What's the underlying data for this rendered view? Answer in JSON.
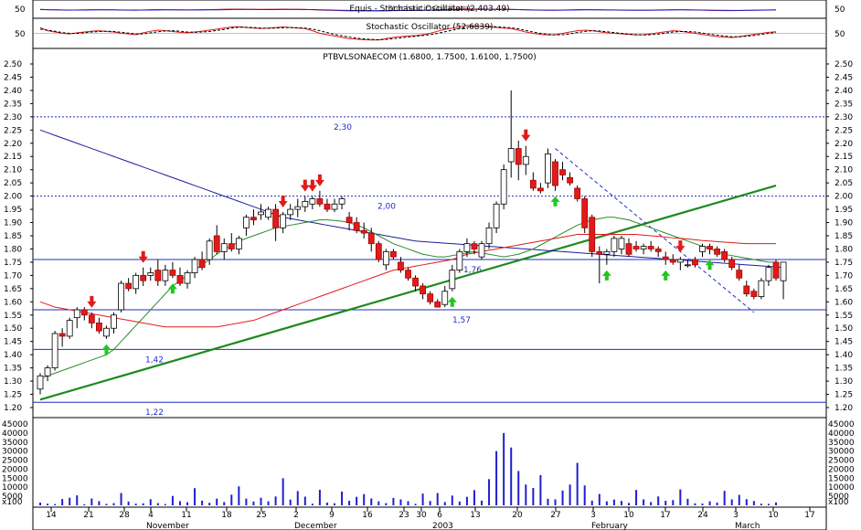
{
  "panels": {
    "top_title": "Equis - Stochastic Oscillator (2,403.49)",
    "top_title_overlap": "Stochastic Oscillator",
    "stoch_title": "Stochastic Oscillator (52.6839)",
    "stoch_label": "50",
    "price_title": "PTBVLSONAECOM (1.6800, 1.7500, 1.6100, 1.7500)",
    "volume_unit": "x100"
  },
  "chart_data": {
    "type": "candlestick",
    "title": "PTBVLSONAECOM (1.6800, 1.7500, 1.6100, 1.7500)",
    "ylim": [
      1.2,
      2.5
    ],
    "y_ticks": [
      "1.20",
      "1.25",
      "1.30",
      "1.35",
      "1.40",
      "1.45",
      "1.50",
      "1.55",
      "1.60",
      "1.65",
      "1.70",
      "1.75",
      "1.80",
      "1.85",
      "1.90",
      "1.95",
      "2.00",
      "2.05",
      "2.10",
      "2.15",
      "2.20",
      "2.25",
      "2.30",
      "2.35",
      "2.40",
      "2.45",
      "2.50"
    ],
    "volume_ylim": [
      0,
      45000
    ],
    "volume_ticks": [
      "5000",
      "10000",
      "15000",
      "20000",
      "25000",
      "30000",
      "35000",
      "40000",
      "45000"
    ],
    "x_ticks": [
      "14",
      "21",
      "28",
      "4",
      "11",
      "18",
      "25",
      "2",
      "9",
      "16",
      "23",
      "30",
      "6",
      "13",
      "20",
      "27",
      "3",
      "10",
      "17",
      "24",
      "3",
      "10",
      "17"
    ],
    "x_months": [
      "November",
      "December",
      "2003",
      "February",
      "March"
    ],
    "horizontal_levels": [
      {
        "value": 2.3,
        "label": "2,30",
        "style": "dotted"
      },
      {
        "value": 2.0,
        "label": "2,00",
        "style": "dotted"
      },
      {
        "value": 1.76,
        "label": "1,76",
        "style": "solid"
      },
      {
        "value": 1.57,
        "label": "1,57",
        "style": "solid"
      },
      {
        "value": 1.42,
        "label": "1,42",
        "style": "solid"
      },
      {
        "value": 1.22,
        "label": "1,22",
        "style": "solid"
      }
    ],
    "candles": [
      [
        1.27,
        1.33,
        1.25,
        1.32
      ],
      [
        1.32,
        1.36,
        1.3,
        1.35
      ],
      [
        1.35,
        1.49,
        1.34,
        1.48
      ],
      [
        1.48,
        1.5,
        1.43,
        1.47
      ],
      [
        1.47,
        1.54,
        1.46,
        1.53
      ],
      [
        1.54,
        1.58,
        1.5,
        1.57
      ],
      [
        1.57,
        1.58,
        1.53,
        1.55
      ],
      [
        1.55,
        1.56,
        1.5,
        1.52
      ],
      [
        1.52,
        1.54,
        1.48,
        1.49
      ],
      [
        1.47,
        1.51,
        1.46,
        1.5
      ],
      [
        1.5,
        1.56,
        1.48,
        1.55
      ],
      [
        1.57,
        1.68,
        1.56,
        1.67
      ],
      [
        1.67,
        1.69,
        1.64,
        1.65
      ],
      [
        1.65,
        1.71,
        1.63,
        1.7
      ],
      [
        1.7,
        1.73,
        1.66,
        1.68
      ],
      [
        1.7,
        1.73,
        1.68,
        1.71
      ],
      [
        1.72,
        1.76,
        1.66,
        1.68
      ],
      [
        1.68,
        1.74,
        1.66,
        1.72
      ],
      [
        1.72,
        1.75,
        1.69,
        1.7
      ],
      [
        1.7,
        1.73,
        1.66,
        1.67
      ],
      [
        1.67,
        1.72,
        1.65,
        1.71
      ],
      [
        1.71,
        1.77,
        1.69,
        1.76
      ],
      [
        1.76,
        1.79,
        1.72,
        1.73
      ],
      [
        1.76,
        1.84,
        1.74,
        1.83
      ],
      [
        1.85,
        1.89,
        1.78,
        1.79
      ],
      [
        1.79,
        1.84,
        1.76,
        1.82
      ],
      [
        1.82,
        1.86,
        1.79,
        1.8
      ],
      [
        1.8,
        1.85,
        1.78,
        1.84
      ],
      [
        1.88,
        1.93,
        1.85,
        1.92
      ],
      [
        1.92,
        1.95,
        1.89,
        1.91
      ],
      [
        1.93,
        1.97,
        1.91,
        1.94
      ],
      [
        1.92,
        1.96,
        1.91,
        1.95
      ],
      [
        1.95,
        1.97,
        1.83,
        1.88
      ],
      [
        1.88,
        1.94,
        1.86,
        1.93
      ],
      [
        1.93,
        1.97,
        1.91,
        1.95
      ],
      [
        1.95,
        1.99,
        1.92,
        1.96
      ],
      [
        1.96,
        2.0,
        1.94,
        1.98
      ],
      [
        1.97,
        2.0,
        1.95,
        1.99
      ],
      [
        1.99,
        2.02,
        1.96,
        1.97
      ],
      [
        1.97,
        1.99,
        1.94,
        1.95
      ],
      [
        1.95,
        1.99,
        1.94,
        1.97
      ],
      [
        1.97,
        2.0,
        1.95,
        1.99
      ],
      [
        1.92,
        1.94,
        1.87,
        1.9
      ],
      [
        1.9,
        1.92,
        1.86,
        1.87
      ],
      [
        1.87,
        1.9,
        1.84,
        1.86
      ],
      [
        1.86,
        1.88,
        1.79,
        1.82
      ],
      [
        1.82,
        1.83,
        1.75,
        1.76
      ],
      [
        1.74,
        1.8,
        1.72,
        1.79
      ],
      [
        1.79,
        1.8,
        1.76,
        1.77
      ],
      [
        1.75,
        1.77,
        1.71,
        1.72
      ],
      [
        1.72,
        1.73,
        1.68,
        1.69
      ],
      [
        1.69,
        1.7,
        1.64,
        1.66
      ],
      [
        1.66,
        1.67,
        1.61,
        1.63
      ],
      [
        1.63,
        1.64,
        1.59,
        1.6
      ],
      [
        1.6,
        1.61,
        1.58,
        1.58
      ],
      [
        1.59,
        1.66,
        1.58,
        1.64
      ],
      [
        1.65,
        1.74,
        1.64,
        1.72
      ],
      [
        1.72,
        1.8,
        1.71,
        1.79
      ],
      [
        1.79,
        1.84,
        1.77,
        1.82
      ],
      [
        1.82,
        1.83,
        1.78,
        1.8
      ],
      [
        1.77,
        1.83,
        1.76,
        1.82
      ],
      [
        1.82,
        1.9,
        1.8,
        1.88
      ],
      [
        1.88,
        1.98,
        1.86,
        1.97
      ],
      [
        1.97,
        2.12,
        1.95,
        2.1
      ],
      [
        2.13,
        2.4,
        2.07,
        2.18
      ],
      [
        2.18,
        2.21,
        2.06,
        2.12
      ],
      [
        2.12,
        2.19,
        2.08,
        2.15
      ],
      [
        2.06,
        2.09,
        2.02,
        2.03
      ],
      [
        2.03,
        2.05,
        2.01,
        2.02
      ],
      [
        2.05,
        2.18,
        2.03,
        2.16
      ],
      [
        2.13,
        2.14,
        2.02,
        2.04
      ],
      [
        2.1,
        2.13,
        2.06,
        2.08
      ],
      [
        2.07,
        2.09,
        2.04,
        2.05
      ],
      [
        2.03,
        2.04,
        1.98,
        1.99
      ],
      [
        1.99,
        2.0,
        1.86,
        1.88
      ],
      [
        1.92,
        1.93,
        1.77,
        1.79
      ],
      [
        1.79,
        1.81,
        1.67,
        1.78
      ],
      [
        1.78,
        1.8,
        1.74,
        1.79
      ],
      [
        1.79,
        1.85,
        1.77,
        1.84
      ],
      [
        1.8,
        1.85,
        1.78,
        1.84
      ],
      [
        1.82,
        1.84,
        1.77,
        1.78
      ],
      [
        1.81,
        1.83,
        1.79,
        1.8
      ],
      [
        1.8,
        1.82,
        1.78,
        1.81
      ],
      [
        1.81,
        1.83,
        1.79,
        1.8
      ],
      [
        1.8,
        1.81,
        1.77,
        1.79
      ],
      [
        1.77,
        1.79,
        1.74,
        1.76
      ],
      [
        1.76,
        1.78,
        1.74,
        1.75
      ],
      [
        1.75,
        1.77,
        1.72,
        1.76
      ],
      [
        1.74,
        1.76,
        1.73,
        1.74
      ],
      [
        1.76,
        1.77,
        1.73,
        1.74
      ],
      [
        1.79,
        1.82,
        1.77,
        1.81
      ],
      [
        1.81,
        1.82,
        1.78,
        1.8
      ],
      [
        1.8,
        1.81,
        1.77,
        1.78
      ],
      [
        1.79,
        1.8,
        1.75,
        1.76
      ],
      [
        1.76,
        1.77,
        1.72,
        1.73
      ],
      [
        1.72,
        1.74,
        1.68,
        1.69
      ],
      [
        1.66,
        1.68,
        1.62,
        1.63
      ],
      [
        1.64,
        1.65,
        1.61,
        1.62
      ],
      [
        1.62,
        1.69,
        1.61,
        1.68
      ],
      [
        1.68,
        1.74,
        1.66,
        1.73
      ],
      [
        1.75,
        1.76,
        1.68,
        1.69
      ],
      [
        1.68,
        1.75,
        1.61,
        1.75
      ]
    ],
    "volumes": [
      1500,
      900,
      700,
      3500,
      4200,
      5500,
      600,
      3800,
      2300,
      800,
      1200,
      6800,
      2100,
      900,
      1100,
      3400,
      1200,
      700,
      5200,
      2300,
      1700,
      9500,
      2600,
      1400,
      3700,
      1800,
      5900,
      10500,
      3700,
      2100,
      4200,
      2200,
      4900,
      15000,
      3200,
      7900,
      4800,
      900,
      8600,
      1500,
      1100,
      7600,
      2500,
      4700,
      6200,
      3800,
      2200,
      1200,
      4100,
      3300,
      2300,
      800,
      6500,
      2400,
      6800,
      1800,
      5400,
      2100,
      4700,
      8400,
      2600,
      14500,
      30000,
      40000,
      32000,
      19000,
      11500,
      9600,
      16700,
      3600,
      3300,
      8200,
      11500,
      23500,
      11000,
      2600,
      6300,
      2200,
      3200,
      2400,
      1300,
      8500,
      3300,
      1800,
      4900,
      2500,
      2900,
      8800,
      3600,
      1100,
      1000,
      2200,
      1500,
      8000,
      3300,
      5800,
      3400,
      2400,
      900,
      800,
      1600
    ],
    "series": [
      {
        "name": "",
        "color": "#1d1d9a",
        "values": [
          2.25,
          2.24,
          2.23,
          2.22,
          2.21,
          2.2,
          2.19,
          2.18,
          2.17,
          2.16,
          2.15,
          2.14,
          2.13,
          2.12,
          2.11,
          2.1,
          2.09,
          2.08,
          2.07,
          2.06,
          2.05,
          2.04,
          2.03,
          2.02,
          2.01,
          2.0,
          1.99,
          1.98,
          1.97,
          1.96,
          1.95,
          1.94,
          1.93,
          1.92,
          1.915,
          1.91,
          1.905,
          1.9,
          1.895,
          1.89,
          1.885,
          1.88,
          1.875,
          1.87,
          1.865,
          1.86,
          1.855,
          1.85,
          1.845,
          1.84,
          1.835,
          1.83,
          1.828,
          1.826,
          1.824,
          1.822,
          1.82,
          1.818,
          1.816,
          1.814,
          1.812,
          1.81,
          1.808,
          1.806,
          1.804,
          1.802,
          1.8,
          1.798,
          1.796,
          1.794,
          1.792,
          1.79,
          1.788,
          1.786,
          1.784,
          1.782,
          1.78,
          1.778,
          1.776,
          1.774,
          1.772,
          1.77,
          1.768,
          1.766,
          1.764,
          1.762,
          1.76,
          1.758,
          1.756,
          1.754,
          1.752,
          1.75,
          1.748,
          1.746,
          1.744,
          1.742,
          1.74,
          1.738,
          1.736,
          1.734,
          1.732,
          1.73
        ]
      },
      {
        "name": "",
        "color": "#2a8a2a",
        "values": [
          1.31,
          1.32,
          1.33,
          1.34,
          1.35,
          1.36,
          1.37,
          1.38,
          1.39,
          1.4,
          1.42,
          1.45,
          1.48,
          1.51,
          1.54,
          1.57,
          1.6,
          1.63,
          1.66,
          1.68,
          1.7,
          1.72,
          1.74,
          1.76,
          1.78,
          1.8,
          1.81,
          1.83,
          1.84,
          1.85,
          1.86,
          1.87,
          1.88,
          1.885,
          1.89,
          1.895,
          1.9,
          1.905,
          1.91,
          1.91,
          1.908,
          1.905,
          1.9,
          1.89,
          1.88,
          1.865,
          1.85,
          1.835,
          1.82,
          1.81,
          1.8,
          1.79,
          1.78,
          1.775,
          1.77,
          1.77,
          1.775,
          1.78,
          1.785,
          1.79,
          1.785,
          1.78,
          1.775,
          1.77,
          1.775,
          1.78,
          1.79,
          1.8,
          1.815,
          1.83,
          1.845,
          1.86,
          1.875,
          1.89,
          1.9,
          1.91,
          1.915,
          1.92,
          1.92,
          1.915,
          1.91,
          1.9,
          1.89,
          1.88,
          1.87,
          1.86,
          1.85,
          1.84,
          1.83,
          1.82,
          1.81,
          1.8,
          1.79,
          1.78,
          1.775,
          1.77,
          1.765,
          1.76,
          1.755,
          1.75,
          1.75
        ]
      },
      {
        "name": "",
        "color": "#e01b1b",
        "values": [
          1.6,
          1.59,
          1.58,
          1.575,
          1.57,
          1.565,
          1.56,
          1.555,
          1.55,
          1.545,
          1.54,
          1.535,
          1.53,
          1.525,
          1.52,
          1.515,
          1.51,
          1.505,
          1.505,
          1.505,
          1.505,
          1.505,
          1.505,
          1.505,
          1.505,
          1.51,
          1.515,
          1.52,
          1.525,
          1.53,
          1.54,
          1.55,
          1.56,
          1.57,
          1.58,
          1.59,
          1.6,
          1.61,
          1.62,
          1.63,
          1.64,
          1.65,
          1.66,
          1.67,
          1.68,
          1.69,
          1.7,
          1.71,
          1.72,
          1.725,
          1.73,
          1.735,
          1.74,
          1.745,
          1.75,
          1.755,
          1.76,
          1.77,
          1.78,
          1.785,
          1.79,
          1.795,
          1.8,
          1.805,
          1.81,
          1.815,
          1.82,
          1.825,
          1.83,
          1.835,
          1.84,
          1.845,
          1.85,
          1.855,
          1.855,
          1.855,
          1.855,
          1.855,
          1.855,
          1.855,
          1.855,
          1.855,
          1.852,
          1.85,
          1.848,
          1.845,
          1.842,
          1.84,
          1.838,
          1.835,
          1.832,
          1.83,
          1.828,
          1.826,
          1.824,
          1.822,
          1.82,
          1.82,
          1.82,
          1.82,
          1.82
        ]
      }
    ],
    "trendlines": [
      {
        "from": [
          0,
          1.23
        ],
        "to": [
          100,
          2.04
        ],
        "color": "#1e8a1e",
        "style": "solid"
      },
      {
        "from": [
          70,
          2.18
        ],
        "to": [
          97,
          1.56
        ],
        "color": "#1f2fbf",
        "style": "dashed"
      }
    ],
    "up_arrows": [
      9,
      18,
      56,
      70,
      77,
      85,
      91
    ],
    "down_arrows": [
      7,
      14,
      33,
      36,
      37,
      38,
      66,
      87
    ],
    "stoch_k": [
      72,
      60,
      55,
      50,
      48,
      52,
      55,
      58,
      60,
      57,
      55,
      50,
      48,
      45,
      52,
      58,
      62,
      60,
      57,
      54,
      52,
      55,
      58,
      62,
      66,
      70,
      74,
      75,
      72,
      70,
      68,
      70,
      72,
      74,
      72,
      70,
      68,
      60,
      50,
      45,
      40,
      35,
      30,
      28,
      26,
      25,
      25,
      30,
      35,
      38,
      40,
      42,
      45,
      50,
      58,
      65,
      70,
      75,
      80,
      78,
      76,
      74,
      72,
      70,
      68,
      62,
      55,
      50,
      46,
      44,
      45,
      50,
      55,
      60,
      62,
      60,
      56,
      52,
      50,
      48,
      46,
      44,
      45,
      48,
      52,
      56,
      60,
      58,
      54,
      50,
      46,
      42,
      38,
      36,
      34,
      38,
      42,
      46,
      50,
      54,
      56
    ],
    "stoch_d": [
      66,
      62,
      58,
      53,
      50,
      50,
      52,
      55,
      57,
      58,
      57,
      54,
      51,
      48,
      48,
      52,
      56,
      59,
      60,
      58,
      55,
      54,
      55,
      57,
      61,
      65,
      70,
      73,
      73,
      72,
      70,
      69,
      70,
      71,
      72,
      71,
      70,
      66,
      60,
      53,
      46,
      41,
      36,
      32,
      29,
      27,
      26,
      27,
      30,
      33,
      36,
      39,
      42,
      45,
      50,
      56,
      62,
      68,
      73,
      76,
      77,
      76,
      75,
      73,
      71,
      67,
      61,
      55,
      50,
      46,
      44,
      45,
      48,
      53,
      57,
      60,
      59,
      56,
      53,
      50,
      47,
      45,
      44,
      45,
      47,
      51,
      55,
      57,
      57,
      55,
      51,
      47,
      43,
      40,
      37,
      37,
      39,
      42,
      46,
      50,
      53
    ],
    "stoch_title": "Stochastic Oscillator (52.6839)"
  }
}
